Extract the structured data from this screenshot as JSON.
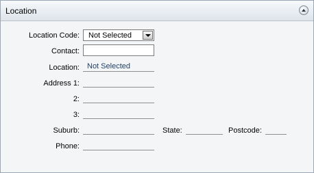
{
  "panel": {
    "title": "Location"
  },
  "form": {
    "location_code_label": "Location Code:",
    "location_code_value": "Not Selected",
    "contact_label": "Contact:",
    "contact_value": "",
    "location_label": "Location:",
    "location_value": "Not Selected",
    "address1_label": "Address 1:",
    "address2_label": "2:",
    "address3_label": "3:",
    "suburb_label": "Suburb:",
    "state_label": "State:",
    "postcode_label": "Postcode:",
    "phone_label": "Phone:"
  }
}
